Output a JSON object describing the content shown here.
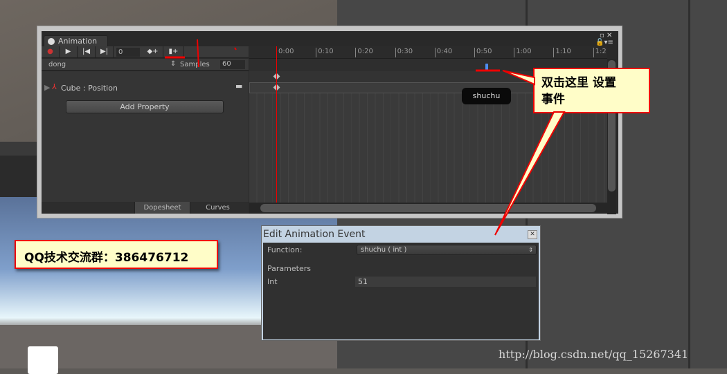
{
  "window": {
    "tab_title": "Animation"
  },
  "toolbar": {
    "frame": "0",
    "record_icon": "record-icon",
    "play_icon": "play-icon",
    "prev_icon": "prev-keyframe-icon",
    "next_icon": "next-keyframe-icon",
    "add_key_icon": "add-keyframe-icon",
    "add_event_icon": "add-event-icon"
  },
  "clip": {
    "name": "dong",
    "samples_label": "Samples",
    "samples": "60"
  },
  "property": {
    "label": "Cube : Position",
    "add_button": "Add Property"
  },
  "bottom_tabs": [
    "Dopesheet",
    "Curves"
  ],
  "ruler_ticks": [
    "0:00",
    "0:10",
    "0:20",
    "0:30",
    "0:40",
    "0:50",
    "1:00",
    "1:10",
    "1:2"
  ],
  "event_tooltip": "shuchu",
  "callout": {
    "line1": "双击这里  设置",
    "line2": "事件"
  },
  "qq_note": "QQ技术交流群：386476712",
  "dialog": {
    "title": "Edit Animation Event",
    "function_label": "Function:",
    "function_value": "shuchu ( int )",
    "parameters_label": "Parameters",
    "int_label": "Int",
    "int_value": "51"
  },
  "watermark": "http://blog.csdn.net/qq_15267341",
  "colors": {
    "annotation_red": "#ee0000",
    "callout_bg": "#fffdc8",
    "event_marker": "#4d8cf0"
  }
}
